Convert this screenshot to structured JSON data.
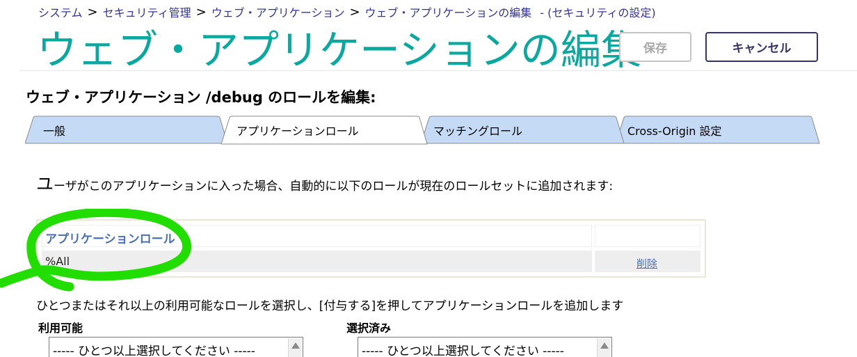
{
  "breadcrumb": {
    "items": [
      "システム",
      "セキュリティ管理",
      "ウェブ・アプリケーション",
      "ウェブ・アプリケーションの編集"
    ],
    "separator": ">",
    "suffix": "- (セキュリティの設定)"
  },
  "page_title": "ウェブ・アプリケーションの編集",
  "buttons": {
    "save": "保存",
    "cancel": "キャンセル"
  },
  "subtitle": "ウェブ・アプリケーション /debug のロールを編集:",
  "tabs": [
    {
      "label": "一般",
      "active": false
    },
    {
      "label": "アプリケーションロール",
      "active": true
    },
    {
      "label": "マッチングロール",
      "active": false
    },
    {
      "label": "Cross-Origin 設定",
      "active": false
    }
  ],
  "description": {
    "first_char": "ユ",
    "rest": "ーザがこのアプリケーションに入った場合、自動的に以下のロールが現在のロールセットに追加されます:"
  },
  "roles_table": {
    "header": "アプリケーションロール",
    "rows": [
      {
        "role": "%All",
        "action": "削除"
      }
    ]
  },
  "instruction": "ひとつまたはそれ以上の利用可能なロールを選択し、[付与する]を押してアプリケーションロールを追加します",
  "available": {
    "label": "利用可能",
    "placeholder": "----- ひとつ以上選択してください -----"
  },
  "selected": {
    "label": "選択済み",
    "placeholder": "----- ひとつ以上選択してください -----"
  },
  "colors": {
    "title": "#0aa89e",
    "link": "#333399",
    "tab_inactive": "#c5daf5",
    "tab_active": "#ffffff",
    "highlight": "#22dd00"
  }
}
